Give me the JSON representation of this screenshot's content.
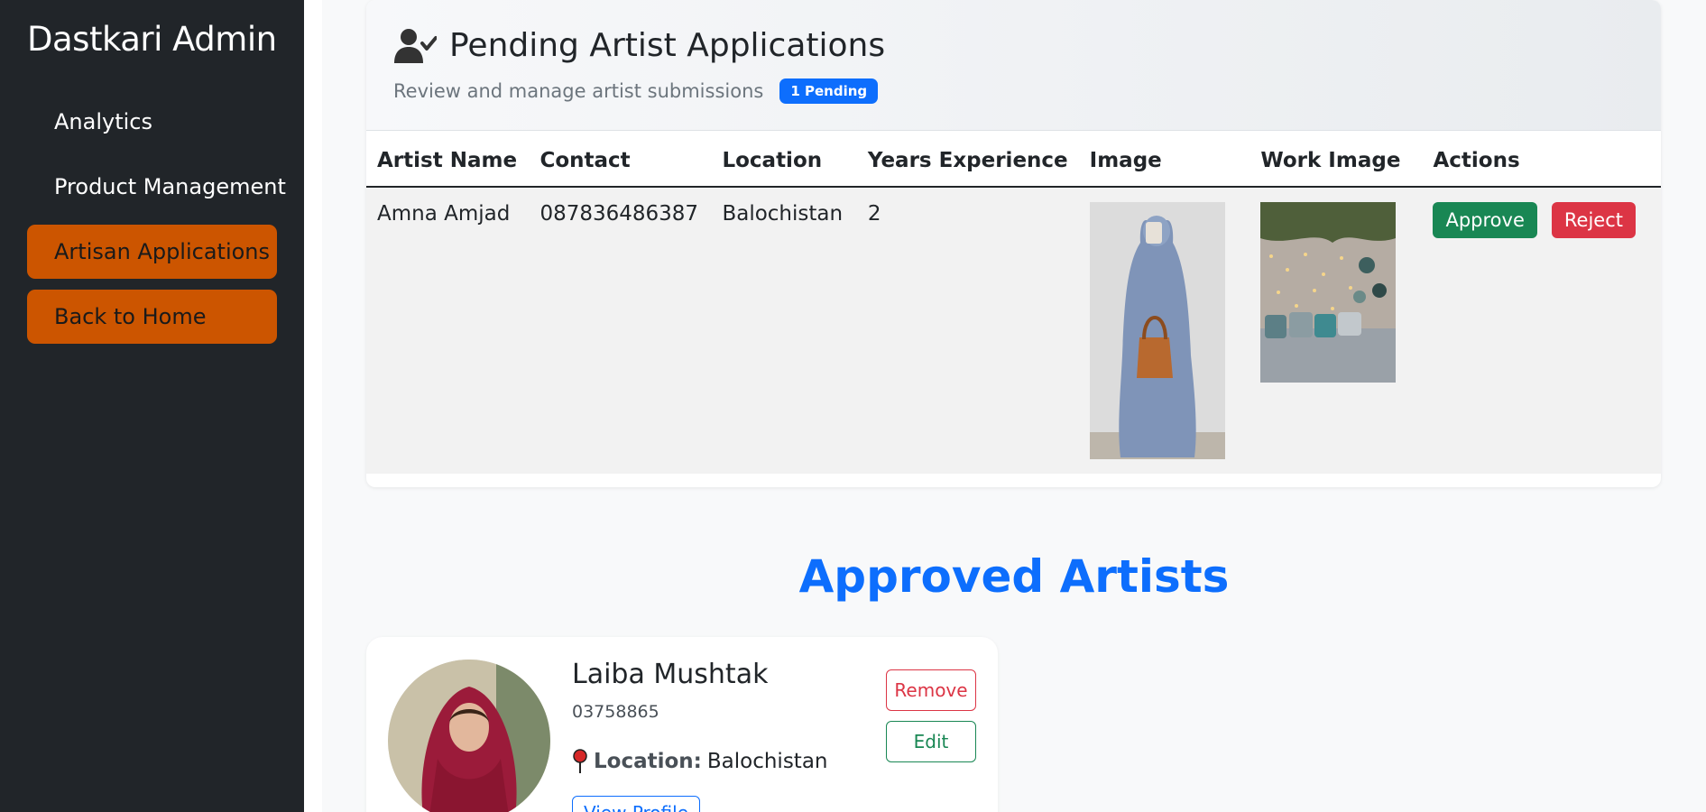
{
  "sidebar": {
    "brand": "Dastkari Admin",
    "items": [
      {
        "label": "Analytics"
      },
      {
        "label": "Product Management"
      },
      {
        "label": "Artisan Applications"
      },
      {
        "label": "Back to Home"
      }
    ]
  },
  "pending": {
    "title": "Pending Artist Applications",
    "subtitle": "Review and manage artist submissions",
    "badge": "1 Pending",
    "columns": [
      "Artist Name",
      "Contact",
      "Location",
      "Years Experience",
      "Image",
      "Work Image",
      "Actions"
    ],
    "rows": [
      {
        "name": "Amna Amjad",
        "contact": "087836486387",
        "location": "Balochistan",
        "years": "2",
        "approve_label": "Approve",
        "reject_label": "Reject"
      }
    ]
  },
  "approved": {
    "heading": "Approved Artists",
    "artists": [
      {
        "name": "Laiba Mushtak",
        "phone": "03758865",
        "location_label": "Location:",
        "location": "Balochistan",
        "view_label": "View Profile",
        "remove_label": "Remove",
        "edit_label": "Edit"
      }
    ]
  },
  "colors": {
    "sidebar_bg": "#212529",
    "active_nav": "#cc5500",
    "primary": "#0d6efd",
    "success": "#198754",
    "danger": "#dc3545"
  }
}
